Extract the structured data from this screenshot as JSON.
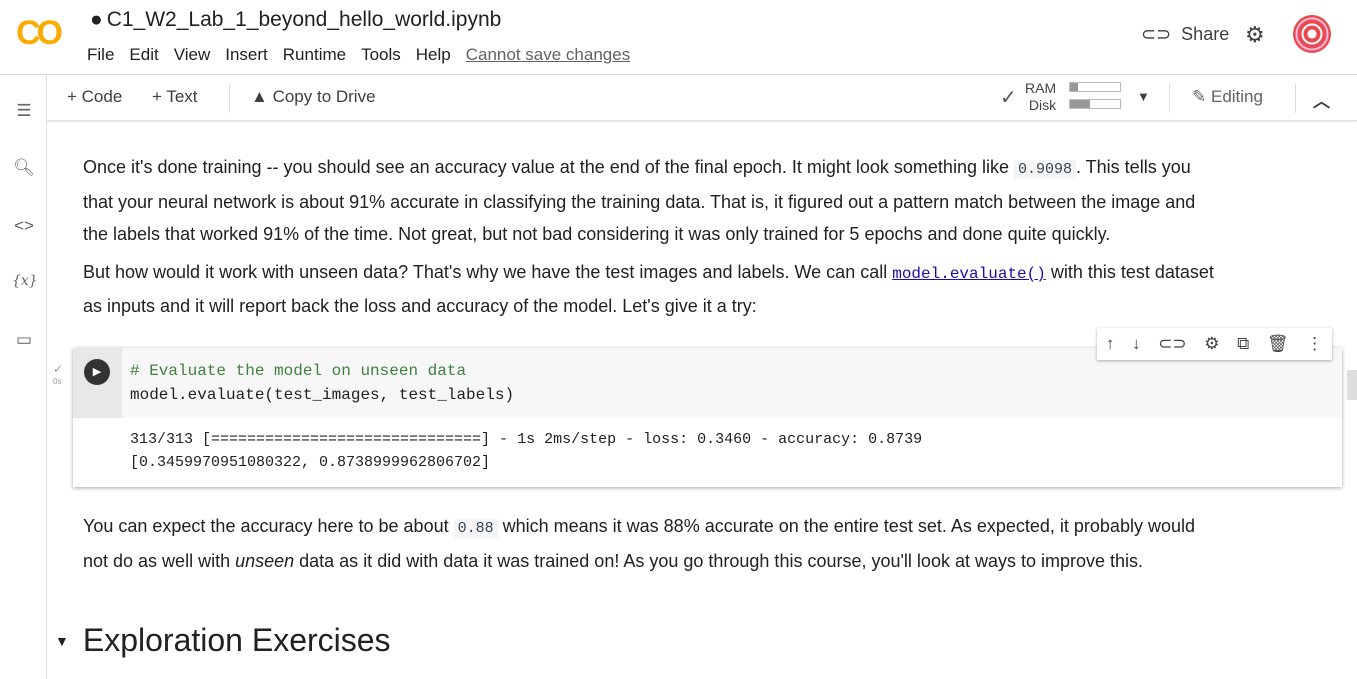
{
  "header": {
    "logo": "CO",
    "title": "C1_W2_Lab_1_beyond_hello_world.ipynb",
    "menu": [
      "File",
      "Edit",
      "View",
      "Insert",
      "Runtime",
      "Tools",
      "Help"
    ],
    "save_status": "Cannot save changes",
    "share": "Share"
  },
  "toolbar": {
    "add_code": "+ Code",
    "add_text": "+ Text",
    "copy_drive": "Copy to Drive",
    "ram": "RAM",
    "disk": "Disk",
    "ram_usage": 0.15,
    "disk_usage": 0.4,
    "editing": "Editing"
  },
  "cell": {
    "comment": "# Evaluate the model on unseen data",
    "code": "model.evaluate(test_images, test_labels)",
    "exec_time": "0s",
    "output_line1": "313/313 [==============================] - 1s 2ms/step - loss: 0.3460 - accuracy: 0.8739",
    "output_line2": "[0.3459970951080322, 0.8738999962806702]"
  },
  "text": {
    "p1a": "Once it's done training -- you should see an accuracy value at the end of the final epoch. It might look something like ",
    "p1code": "0.9098",
    "p1b": ". This tells you",
    "p1c": "that your neural network is about 91% accurate in classifying the training data. That is, it figured out a pattern match between the image and",
    "p1d": "the labels that worked 91% of the time. Not great, but not bad considering it was only trained for 5 epochs and done quite quickly.",
    "p2a": "But how would it work with unseen data? That's why we have the test images and labels. We can call ",
    "p2link": "model.evaluate()",
    "p2b": " with this test dataset",
    "p2c": "as inputs and it will report back the loss and accuracy of the model. Let's give it a try:",
    "p3a": "You can expect the accuracy here to be about ",
    "p3code": "0.88",
    "p3b": " which means it was 88% accurate on the entire test set. As expected, it probably would",
    "p3c": "not do as well with ",
    "p3em": "unseen",
    "p3d": " data as it did with data it was trained on! As you go through this course, you'll look at ways to improve this."
  },
  "section": {
    "title": "Exploration Exercises"
  }
}
